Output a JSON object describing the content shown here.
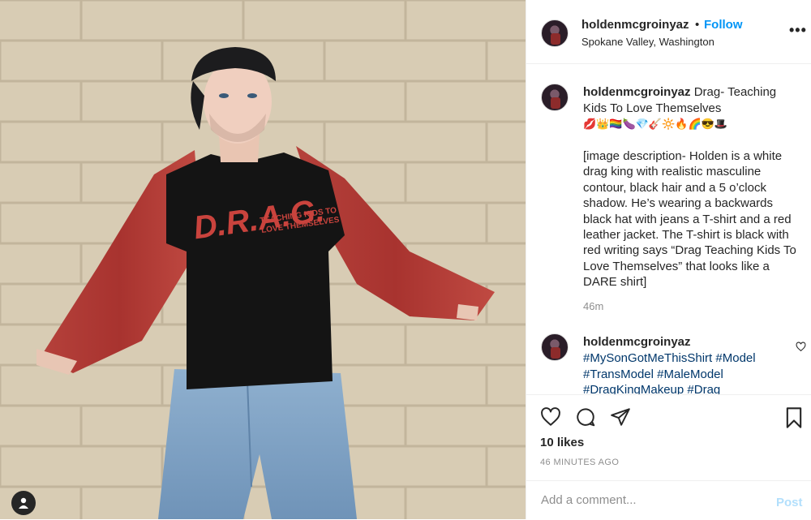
{
  "photo": {
    "shirt_line1": "D.R.A.G.",
    "shirt_line2": "TEACHING KIDS TO",
    "shirt_line3": "LOVE THEMSELVES"
  },
  "header": {
    "username": "holdenmcgroinyaz",
    "separator": "•",
    "follow_label": "Follow",
    "location": "Spokane Valley, Washington",
    "more_label": "•••"
  },
  "caption": {
    "username": "holdenmcgroinyaz",
    "text": "Drag- Teaching Kids To Love Themselves",
    "emojis": "💋👑🏳️‍🌈🍆💎🎸🔆🔥🌈😎🎩",
    "description": "[image description- Holden is a white drag king with realistic masculine contour, black hair and a 5 o’clock shadow. He’s wearing a backwards black hat with jeans a T-shirt and a red leather jacket. The T-shirt is black with red writing says “Drag Teaching Kids To Love Themselves” that looks like a DARE shirt]",
    "time": "46m"
  },
  "comment": {
    "username": "holdenmcgroinyaz",
    "hashtags": "#MySonGotMeThisShirt #Model #TransModel #MaleModel #DragKingMakeup #Drag"
  },
  "actions": {
    "likes": "10 likes",
    "posted_ago": "46 MINUTES AGO"
  },
  "add_comment": {
    "placeholder": "Add a comment...",
    "post_label": "Post"
  },
  "colors": {
    "accent": "#0095f6",
    "post_disabled": "#b2dffc",
    "hashtag": "#00376b",
    "jacket": "#a8332f"
  }
}
